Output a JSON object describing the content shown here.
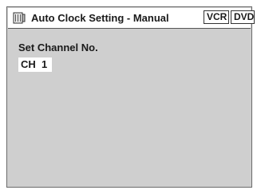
{
  "header": {
    "title": "Auto Clock Setting - Manual",
    "icon": "clock-setting-icon",
    "badges": [
      "VCR",
      "DVD"
    ]
  },
  "main": {
    "section_label": "Set Channel No.",
    "channel_value": "CH  1"
  },
  "colors": {
    "panel_background": "#cfcfcf",
    "header_background": "#ffffff",
    "text": "#1a1a1a",
    "border": "#555555"
  }
}
